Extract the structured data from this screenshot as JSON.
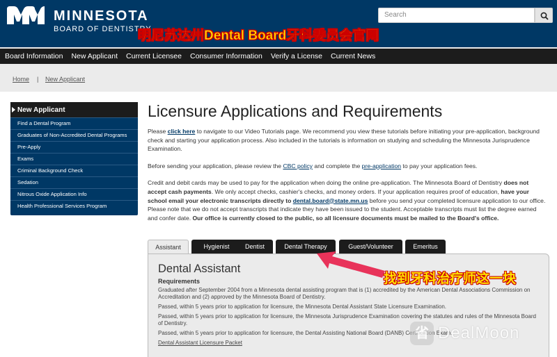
{
  "header": {
    "logo_word": "MINNESOTA",
    "logo_sub": "BOARD OF DENTISTRY",
    "annotation_title": "明尼苏达州Dental Board牙科委员会官网",
    "search_placeholder": "Search"
  },
  "nav": [
    "Board Information",
    "New Applicant",
    "Current Licensee",
    "Consumer Information",
    "Verify a License",
    "Current News"
  ],
  "breadcrumb": {
    "home": "Home",
    "sep": "|",
    "current": "New Applicant"
  },
  "sidebar": {
    "heading": "New Applicant",
    "items": [
      "Find a Dental Program",
      "Graduates of Non-Accredited Dental Programs",
      "Pre-Apply",
      "Exams",
      "Criminal Background Check",
      "Sedation",
      "Nitrous Oxide Application Info",
      "Health Professional Services Program"
    ]
  },
  "article": {
    "title": "Licensure Applications and Requirements",
    "p1_pre": "Please ",
    "p1_link": "click here",
    "p1_post": " to navigate to our Video Tutorials page. We recommend you view these tutorials before initiating your pre-application, background check and starting your application process. Also included in the tutorials is information on studying and scheduling the Minnesota Jurisprudence Examination.",
    "p2_pre": "Before sending your application, please review the ",
    "p2_link1": "CBC policy",
    "p2_mid": " and complete the ",
    "p2_link2": "pre-application",
    "p2_post": " to pay your application fees.",
    "p3_a": "Credit and debit cards may be used to pay for the application when doing the online pre-application. The Minnesota Board of Dentistry ",
    "p3_b": "does not accept cash payments",
    "p3_c": ". We only accept checks, cashier's checks, and money orders. If your application requires proof of education, ",
    "p3_d": "have your school email your electronic transcripts directly to ",
    "p3_e": "dental.board@state.mn.us",
    "p3_f": " before you send your completed licensure application to our office. Please note that we do not accept transcripts that indicate they have been issued to the student. Acceptable transcripts must list the degree earned and confer date. ",
    "p3_g": "Our office is currently closed to the public, so all licensure documents must be mailed to the Board's office."
  },
  "tabs": [
    "Assistant",
    "Hygienist",
    "Dentist",
    "Dental Therapy",
    "Guest/Volunteer",
    "Emeritus"
  ],
  "active_tab": "Assistant",
  "panel": {
    "heading": "Dental Assistant",
    "subheading": "Requirements",
    "lines": [
      "Graduated after September 2004 from a Minnesota dental assisting program that is (1) accredited by the American Dental Associations Commission on Accreditation and (2) approved by the Minnesota Board of Dentistry.",
      "Passed, within 5 years prior to application for licensure, the Minnesota Dental Assistant State Licensure Examination.",
      "Passed, within 5 years prior to application for licensure, the Minnesota Jurisprudence Examination covering the statutes and rules of the Minnesota Board of Dentistry.",
      "Passed, within 5 years prior to application for licensure, the Dental Assisting National Board (DANB) Certification Exam."
    ],
    "link": "Dental Assistant Licensure Packet"
  },
  "annotation_note": "找到牙科治疗师这一块",
  "watermark": {
    "badge": "省",
    "text": "DealMoon"
  },
  "colors": {
    "brand_blue": "#003865",
    "nav_black": "#1c1c1c",
    "annotation_yellow": "#ffe000",
    "annotation_red": "#e8335a"
  }
}
